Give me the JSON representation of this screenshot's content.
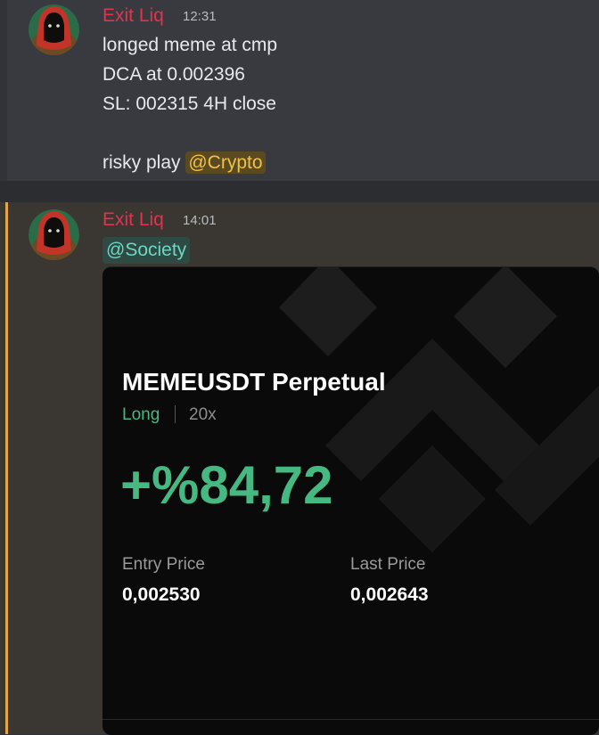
{
  "colors": {
    "username": "#e0344e",
    "mention_crypto_text": "#f0c04a",
    "mention_society_text": "#6dd6c4",
    "profit_green": "#46b881",
    "highlight_bar": "#e5a44a"
  },
  "messages": [
    {
      "username": "Exit Liq",
      "timestamp": "12:31",
      "lines": [
        "longed meme at cmp",
        "DCA at 0.002396",
        "SL: 002315 4H close"
      ],
      "last_line_prefix": "risky play ",
      "mention": "@Crypto"
    },
    {
      "username": "Exit Liq",
      "timestamp": "14:01",
      "mention": "@Society"
    }
  ],
  "trade_card": {
    "pair": "MEMEUSDT Perpetual",
    "side": "Long",
    "leverage": "20x",
    "pnl": "+%84,72",
    "entry_label": "Entry Price",
    "entry_value": "0,002530",
    "last_label": "Last Price",
    "last_value": "0,002643"
  }
}
